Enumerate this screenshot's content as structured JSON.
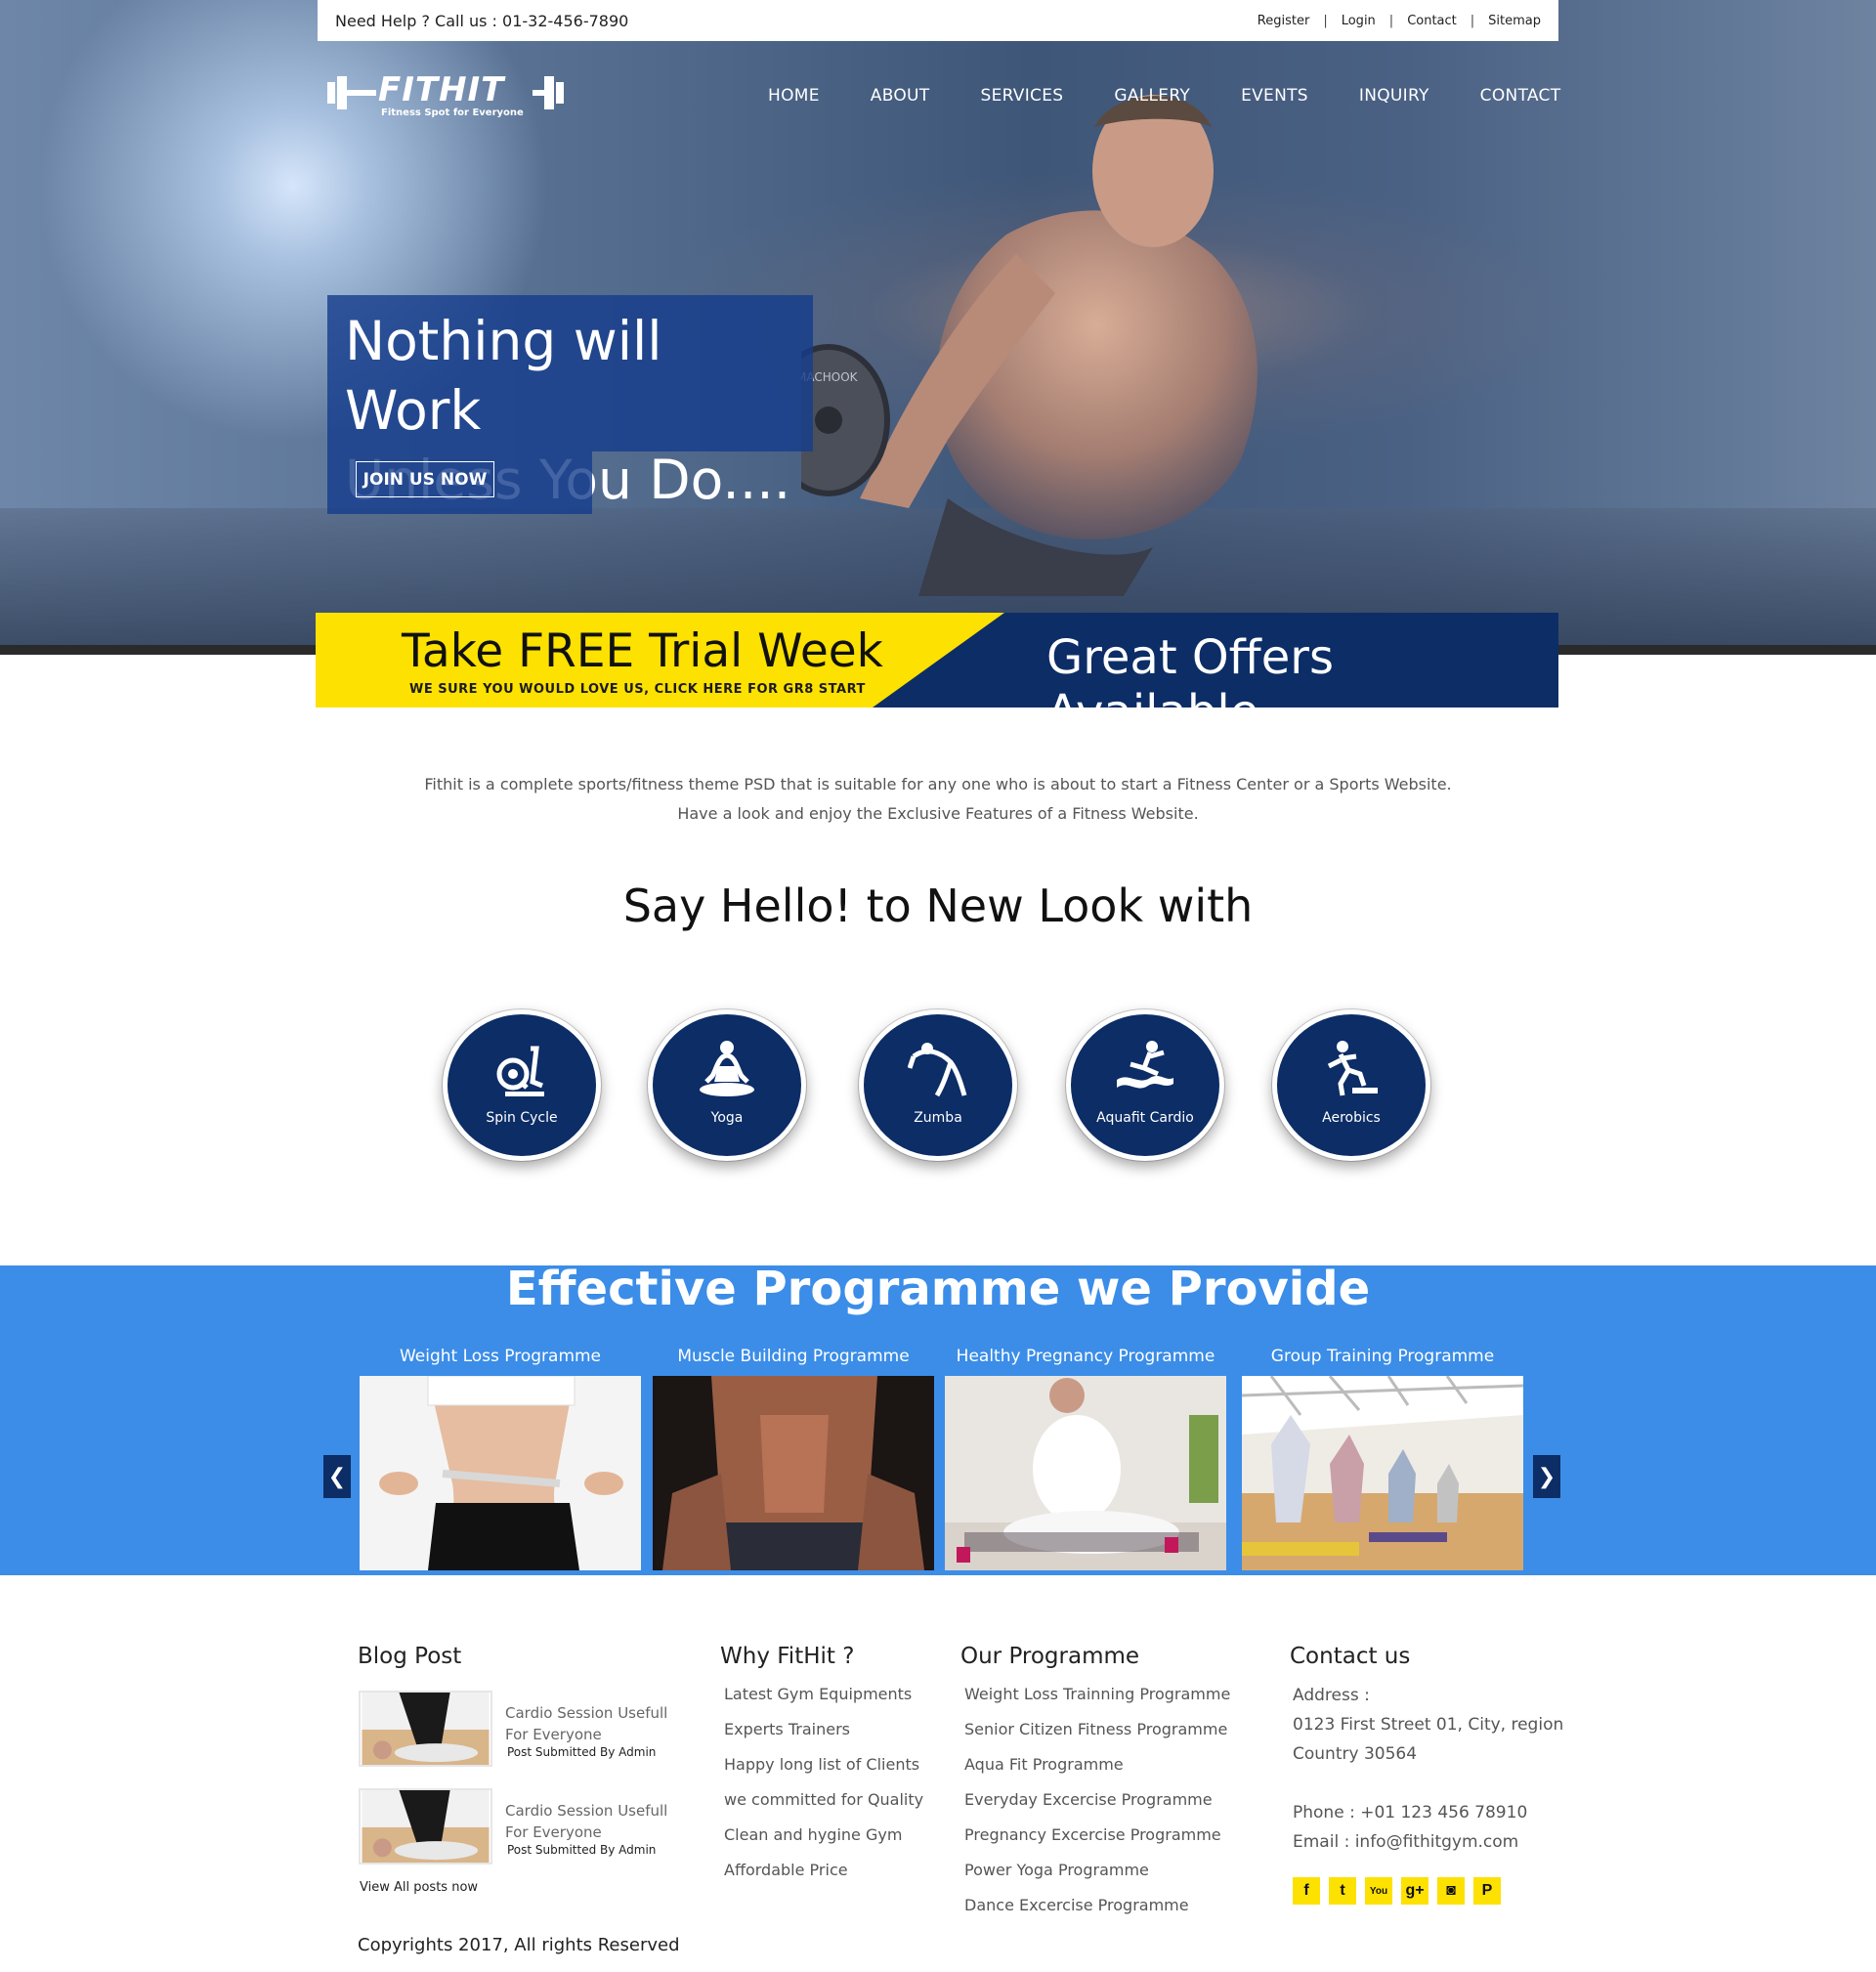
{
  "topbar": {
    "help": "Need Help ? Call us : 01-32-456-7890",
    "links": [
      "Register",
      "Login",
      "Contact",
      "Sitemap"
    ],
    "separator": "|"
  },
  "logo": {
    "brand": "FITHIT",
    "tagline": "Fitness Spot for Everyone"
  },
  "nav": [
    "HOME",
    "ABOUT",
    "SERVICES",
    "GALLERY",
    "EVENTS",
    "INQUIRY",
    "CONTACT"
  ],
  "hero": {
    "headline_line1": "Nothing will Work",
    "headline_line2": "Unless You Do....",
    "cta": "JOIN US NOW",
    "dumbbell_text": "MACHOOK"
  },
  "offer": {
    "title": "Take FREE Trial Week",
    "subtitle": "WE SURE YOU WOULD LOVE US, CLICK HERE FOR GR8 START",
    "right": "Great Offers Available"
  },
  "intro": {
    "line1": "Fithit is a complete sports/fitness theme PSD that is suitable for any one who is about to start a Fitness Center or a Sports Website.",
    "line2": "Have a look and enjoy the Exclusive Features of a Fitness Website."
  },
  "hello_title": "Say Hello! to New Look with",
  "features": [
    {
      "label": "Spin Cycle",
      "icon": "spin-cycle-icon"
    },
    {
      "label": "Yoga",
      "icon": "yoga-icon"
    },
    {
      "label": "Zumba",
      "icon": "zumba-icon"
    },
    {
      "label": "Aquafit Cardio",
      "icon": "aquafit-icon"
    },
    {
      "label": "Aerobics",
      "icon": "aerobics-icon"
    }
  ],
  "programme": {
    "title": "Effective Programme we Provide",
    "items": [
      {
        "label": "Weight Loss Programme"
      },
      {
        "label": "Muscle Building Programme"
      },
      {
        "label": "Healthy Pregnancy Programme"
      },
      {
        "label": "Group Training Programme"
      }
    ],
    "prev": "❮",
    "next": "❯"
  },
  "footer": {
    "blog": {
      "title": "Blog Post",
      "posts": [
        {
          "title": "Cardio Session Usefull For Everyone",
          "by": "Post Submitted By Admin"
        },
        {
          "title": "Cardio Session Usefull For Everyone",
          "by": "Post Submitted By Admin"
        }
      ],
      "view_all": "View All posts now"
    },
    "why": {
      "title": "Why FitHit ?",
      "items": [
        "Latest Gym Equipments",
        "Experts Trainers",
        "Happy long list of Clients",
        "we committed for Quality",
        "Clean and hygine Gym",
        "Affordable Price"
      ]
    },
    "programme": {
      "title": "Our Programme",
      "items": [
        "Weight Loss Trainning Programme",
        "Senior Citizen Fitness Programme",
        "Aqua Fit Programme",
        "Everyday Excercise Programme",
        "Pregnancy Excercise Programme",
        "Power Yoga Programme",
        "Dance Excercise Programme"
      ]
    },
    "contact": {
      "title": "Contact us",
      "address_label": "Address :",
      "address_line1": "0123 First Street 01, City, region",
      "address_line2": "Country 30564",
      "phone": "Phone : +01 123 456 78910",
      "email": "Email : info@fithitgym.com",
      "socials": [
        {
          "name": "facebook-icon",
          "glyph": "f"
        },
        {
          "name": "twitter-icon",
          "glyph": "t"
        },
        {
          "name": "youtube-icon",
          "glyph": "You"
        },
        {
          "name": "google-plus-icon",
          "glyph": "g+"
        },
        {
          "name": "instagram-icon",
          "glyph": "◙"
        },
        {
          "name": "pinterest-icon",
          "glyph": "P"
        }
      ]
    },
    "copyright": "Copyrights 2017, All rights Reserved"
  },
  "colors": {
    "navy": "#0c2d66",
    "yellow": "#fde100",
    "blue_band": "#3b8de8"
  }
}
